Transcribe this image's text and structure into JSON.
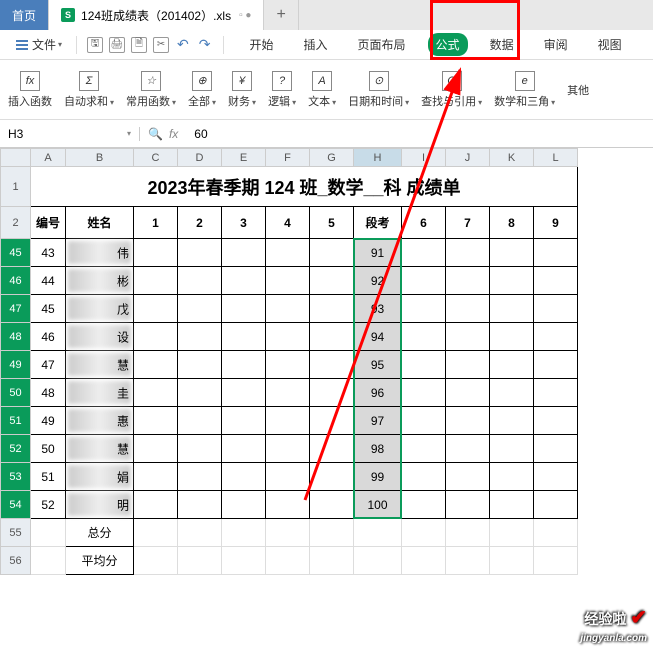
{
  "tabs": {
    "home": "首页",
    "file": "124班成绩表（201402）.xls",
    "new": "+"
  },
  "menubar": {
    "file": "文件",
    "undo": "↶",
    "redo": "↷"
  },
  "ribbon_tabs": [
    "开始",
    "插入",
    "页面布局",
    "公式",
    "数据",
    "审阅",
    "视图"
  ],
  "ribbon_active_index": 3,
  "ribbon_groups": [
    {
      "icon": "fx",
      "label": "插入函数"
    },
    {
      "icon": "Σ",
      "label": "自动求和"
    },
    {
      "icon": "☆",
      "label": "常用函数"
    },
    {
      "icon": "⊕",
      "label": "全部"
    },
    {
      "icon": "¥",
      "label": "财务"
    },
    {
      "icon": "?",
      "label": "逻辑"
    },
    {
      "icon": "A",
      "label": "文本"
    },
    {
      "icon": "⊙",
      "label": "日期和时间"
    },
    {
      "icon": "Q",
      "label": "查找与引用"
    },
    {
      "icon": "e",
      "label": "数学和三角"
    },
    {
      "icon": "",
      "label": "其他"
    }
  ],
  "formulabar": {
    "name_box": "H3",
    "fx": "fx",
    "value": "60"
  },
  "columns": [
    "A",
    "B",
    "C",
    "D",
    "E",
    "F",
    "G",
    "H",
    "I",
    "J",
    "K",
    "L"
  ],
  "selected_col": "H",
  "title": "2023年春季期 124 班_数学__科 成绩单",
  "header_row": [
    "编号",
    "姓名",
    "1",
    "2",
    "3",
    "4",
    "5",
    "段考",
    "6",
    "7",
    "8",
    "9"
  ],
  "rows": [
    {
      "r": 45,
      "num": "43",
      "last": "伟",
      "score": "91"
    },
    {
      "r": 46,
      "num": "44",
      "last": "彬",
      "score": "92"
    },
    {
      "r": 47,
      "num": "45",
      "last": "戊",
      "score": "93"
    },
    {
      "r": 48,
      "num": "46",
      "last": "设",
      "score": "94"
    },
    {
      "r": 49,
      "num": "47",
      "last": "慧",
      "score": "95"
    },
    {
      "r": 50,
      "num": "48",
      "last": "圭",
      "score": "96"
    },
    {
      "r": 51,
      "num": "49",
      "last": "惠",
      "score": "97"
    },
    {
      "r": 52,
      "num": "50",
      "last": "慧",
      "score": "98"
    },
    {
      "r": 53,
      "num": "51",
      "last": "娟",
      "score": "99"
    },
    {
      "r": 54,
      "num": "52",
      "last": "明",
      "score": "100"
    }
  ],
  "summary": {
    "total": "总分",
    "avg": "平均分"
  },
  "summary_rows": [
    "55",
    "56"
  ],
  "watermark": {
    "main": "经验啦",
    "sub": "jingyanla.com"
  }
}
